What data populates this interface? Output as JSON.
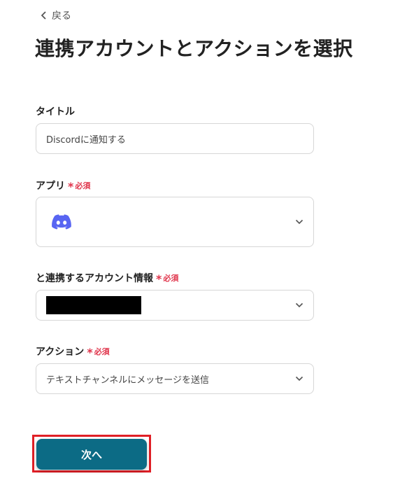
{
  "back_link": "戻る",
  "page_title": "連携アカウントとアクションを選択",
  "form": {
    "title_field": {
      "label": "タイトル",
      "value": "Discordに通知する"
    },
    "app_field": {
      "label": "アプリ",
      "required": "必須",
      "selected_icon": "discord-icon"
    },
    "account_field": {
      "label": "と連携するアカウント情報",
      "required": "必須",
      "value_redacted": true
    },
    "action_field": {
      "label": "アクション",
      "required": "必須",
      "value": "テキストチャンネルにメッセージを送信"
    }
  },
  "next_button": "次へ",
  "colors": {
    "required": "#e0344b",
    "primary": "#0c6b85",
    "highlight": "#e01f26",
    "discord": "#5865f2"
  }
}
